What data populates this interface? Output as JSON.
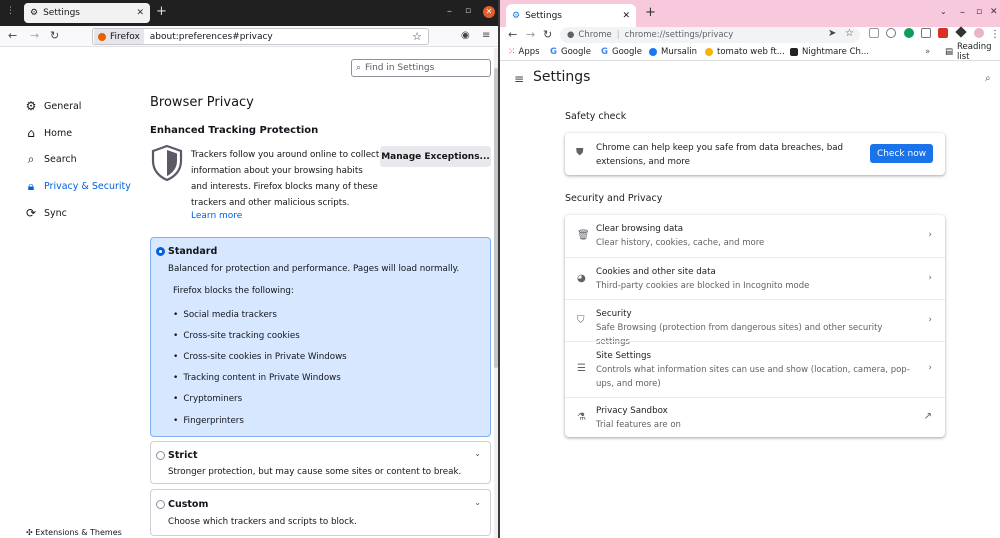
{
  "firefox": {
    "tab_title": "Settings",
    "url_identity": "Firefox",
    "url": "about:preferences#privacy",
    "search_placeholder": "Find in Settings",
    "sidebar": [
      {
        "label": "General",
        "icon": "gear-icon"
      },
      {
        "label": "Home",
        "icon": "home-icon"
      },
      {
        "label": "Search",
        "icon": "search-icon"
      },
      {
        "label": "Privacy & Security",
        "icon": "lock-icon",
        "active": true
      },
      {
        "label": "Sync",
        "icon": "sync-icon"
      }
    ],
    "extensions_label": "Extensions & Themes",
    "page_title": "Browser Privacy",
    "etp_title": "Enhanced Tracking Protection",
    "etp_desc": "Trackers follow you around online to collect information about your browsing habits and interests. Firefox blocks many of these trackers and other malicious scripts.",
    "learn_more": "Learn more",
    "manage_exceptions": "Manage Exceptions...",
    "standard": {
      "title": "Standard",
      "desc": "Balanced for protection and performance. Pages will load normally.",
      "blocks_heading": "Firefox blocks the following:",
      "blocks": [
        "Social media trackers",
        "Cross-site tracking cookies",
        "Cross-site cookies in Private Windows",
        "Tracking content in Private Windows",
        "Cryptominers",
        "Fingerprinters"
      ]
    },
    "strict": {
      "title": "Strict",
      "desc": "Stronger protection, but may cause some sites or content to break."
    },
    "custom": {
      "title": "Custom",
      "desc": "Choose which trackers and scripts to block."
    },
    "accent_color": "#0060df"
  },
  "chrome": {
    "tab_title": "Settings",
    "omnibox_chip": "Chrome",
    "url": "chrome://settings/privacy",
    "bookmarks": [
      {
        "label": "Apps",
        "color": "#5f6368"
      },
      {
        "label": "Google",
        "color": "#4285f4"
      },
      {
        "label": "Google",
        "color": "#4285f4"
      },
      {
        "label": "Mursalin",
        "color": "#1877f2"
      },
      {
        "label": "tomato web ft...",
        "color": "#f6b400"
      },
      {
        "label": "Nightmare Ch...",
        "color": "#222222"
      }
    ],
    "reading_list": "Reading list",
    "page_title": "Settings",
    "safety_check": {
      "heading": "Safety check",
      "text": "Chrome can help keep you safe from data breaches, bad extensions, and more",
      "button": "Check now"
    },
    "security_privacy": {
      "heading": "Security and Privacy",
      "rows": [
        {
          "label": "Clear browsing data",
          "sub": "Clear history, cookies, cache, and more",
          "icon": "trash-icon"
        },
        {
          "label": "Cookies and other site data",
          "sub": "Third-party cookies are blocked in Incognito mode",
          "icon": "cookie-icon"
        },
        {
          "label": "Security",
          "sub": "Safe Browsing (protection from dangerous sites) and other security settings",
          "icon": "shield-icon"
        },
        {
          "label": "Site Settings",
          "sub": "Controls what information sites can use and show (location, camera, pop-ups, and more)",
          "icon": "sliders-icon"
        },
        {
          "label": "Privacy Sandbox",
          "sub": "Trial features are on",
          "icon": "flask-icon"
        }
      ]
    },
    "accent_color": "#1a73e8",
    "tab_strip_color": "#f8c8dc"
  }
}
